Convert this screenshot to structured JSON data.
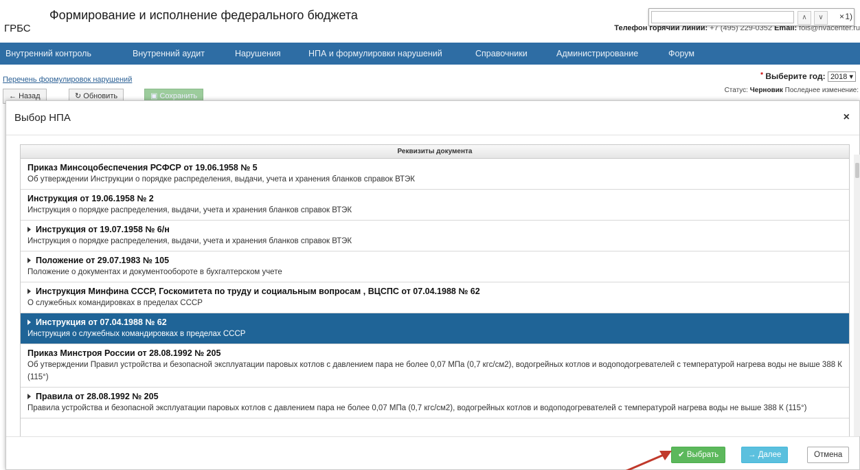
{
  "header": {
    "title": "Формирование и исполнение федерального бюджета",
    "subtitle": "ГРБС",
    "hotline_label": "Телефон горячий линии:",
    "hotline_phone": "+7 (495) 229-0352",
    "email_label": "Email:",
    "email_value": "fois@nvacenter.ru",
    "find_value": "",
    "find_close": "×",
    "find_paren": "1)"
  },
  "nav": {
    "items": [
      "Внутренний контроль",
      "Внутренний аудит",
      "Нарушения",
      "НПА и формулировки нарушений",
      "Справочники",
      "Администрирование",
      "Форум"
    ]
  },
  "page": {
    "breadcrumb": "Перечень формулировок нарушений",
    "year_label": "Выберите год:",
    "year_value": "2018",
    "status_label": "Статус:",
    "status_value": "Черновик",
    "last_change_label": "Последнее изменение:",
    "back_label": "Назад",
    "refresh_label": "Обновить",
    "save_label": "Сохранить"
  },
  "modal": {
    "title": "Выбор НПА",
    "close": "×",
    "grid_header": "Реквизиты документа",
    "rows": [
      {
        "title": "Приказ Минсоцобеспечения РСФСР от 19.06.1958 № 5",
        "desc": "Об утверждении Инструкции о порядке распределения, выдачи, учета и хранения бланков справок ВТЭК",
        "expandable": false,
        "selected": false
      },
      {
        "title": "Инструкция от 19.06.1958 № 2",
        "desc": "Инструкция о порядке распределения, выдачи, учета и хранения бланков справок ВТЭК",
        "expandable": false,
        "selected": false
      },
      {
        "title": "Инструкция от 19.07.1958 № 6/н",
        "desc": "Инструкция о порядке распределения, выдачи, учета и хранения бланков справок ВТЭК",
        "expandable": true,
        "selected": false
      },
      {
        "title": "Положение от 29.07.1983 № 105",
        "desc": "Положение о документах и документообороте в бухгалтерском учете",
        "expandable": true,
        "selected": false
      },
      {
        "title": "Инструкция Минфина СССР, Госкомитета по труду и социальным вопросам , ВЦСПС от 07.04.1988 № 62",
        "desc": "О служебных командировках в пределах СССР",
        "expandable": true,
        "selected": false
      },
      {
        "title": "Инструкция от 07.04.1988 № 62",
        "desc": "Инструкция о служебных командировках в пределах СССР",
        "expandable": true,
        "selected": true
      },
      {
        "title": "Приказ Минстроя России от 28.08.1992 № 205",
        "desc": "Об утверждении Правил устройства и безопасной эксплуатации паровых котлов с давлением пара не более 0,07 МПа (0,7 кгс/см2), водогрейных котлов и водоподогревателей с температурой нагрева воды не выше 388 К (115°)",
        "expandable": false,
        "selected": false
      },
      {
        "title": "Правила от 28.08.1992 № 205",
        "desc": "Правила устройства и безопасной эксплуатации паровых котлов с давлением пара не более 0,07 МПа (0,7 кгс/см2), водогрейных котлов и водоподогревателей с температурой нагрева воды не выше 388 К (115°)",
        "expandable": true,
        "selected": false
      }
    ],
    "buttons": {
      "select": "Выбрать",
      "next": "Далее",
      "cancel": "Отмена"
    }
  },
  "colors": {
    "nav_bg": "#2e6da4",
    "selected_row": "#1f6497",
    "select_btn": "#5cb85c",
    "next_btn": "#5bc0de",
    "arrow": "#c0392b"
  }
}
